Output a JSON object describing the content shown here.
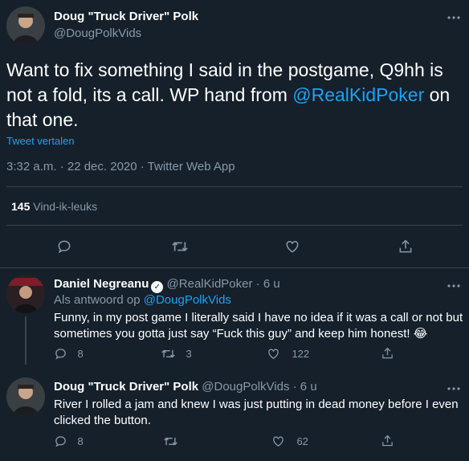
{
  "main_tweet": {
    "author_name": "Doug \"Truck Driver\" Polk",
    "author_handle": "@DougPolkVids",
    "text_before_mention": "Want to fix something I said in the postgame, Q9hh is not a fold, its a call. WP hand from ",
    "mention": "@RealKidPoker",
    "text_after_mention": " on that one.",
    "translate_link": "Tweet vertalen",
    "timestamp": "3:32 a.m. · 22 dec. 2020 · Twitter Web App",
    "likes_count": "145",
    "likes_label": "Vind-ik-leuks",
    "more_icon": "more-horizontal-icon"
  },
  "replies": [
    {
      "author_name": "Daniel Negreanu",
      "verified": true,
      "author_handle": "@RealKidPoker",
      "time": "· 6 u",
      "reply_to_label": "Als antwoord op ",
      "reply_to_handle": "@DougPolkVids",
      "text": "Funny, in my post game I literally said I have no idea if it was a call or not but sometimes you gotta just say “Fuck this guy” and keep him honest! 😂",
      "reply_count": "8",
      "retweet_count": "3",
      "like_count": "122"
    },
    {
      "author_name": "Doug \"Truck Driver\" Polk",
      "verified": false,
      "author_handle": "@DougPolkVids",
      "time": "· 6 u",
      "text": "River I rolled a jam and knew I was just putting in dead money before I even clicked the button.",
      "reply_count": "8",
      "retweet_count": "",
      "like_count": "62"
    }
  ],
  "colors": {
    "background": "#15202b",
    "accent": "#1da1f2",
    "muted": "#8899a6",
    "divider": "#38444d"
  }
}
